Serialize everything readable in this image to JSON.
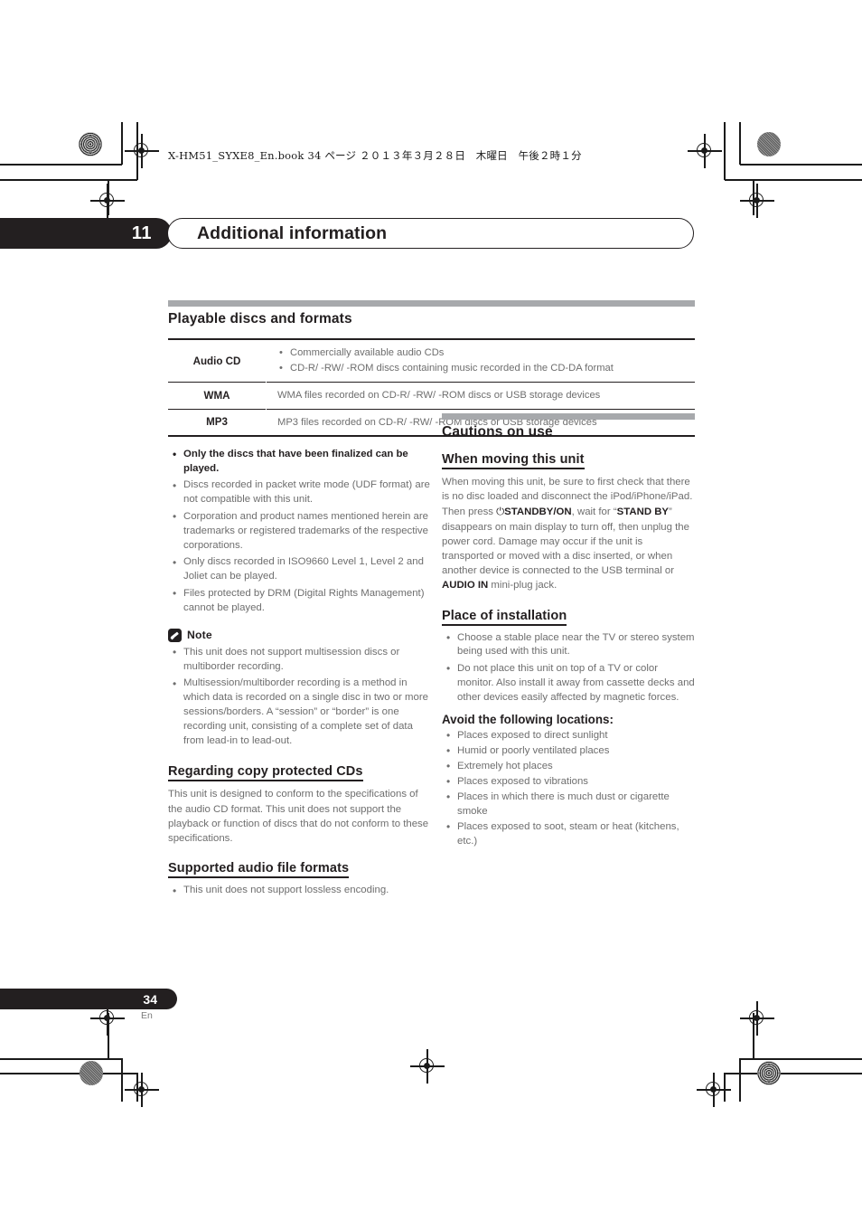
{
  "print_header": {
    "book_line": "X-HM51_SYXE8_En.book  34 ページ  ２０１３年３月２８日　木曜日　午後２時１分"
  },
  "chapter": {
    "number": "11",
    "title": "Additional information"
  },
  "left_column": {
    "section": {
      "title": "Playable discs and formats",
      "table": {
        "rows": [
          {
            "format": "Audio CD",
            "items": [
              "Commercially available audio CDs",
              "CD-R/ -RW/ -ROM discs containing music recorded in the CD-DA format"
            ]
          },
          {
            "format": "WMA",
            "items": [
              "WMA files recorded on CD-R/ -RW/ -ROM discs or USB storage devices"
            ]
          },
          {
            "format": "MP3",
            "items": [
              "MP3 files recorded on CD-R/ -RW/ -ROM discs or USB storage devices"
            ]
          }
        ]
      }
    },
    "notes_list": [
      "Only the discs that have been finalized can be played.",
      "Discs recorded in packet write mode (UDF format) are not compatible with this unit.",
      "Corporation and product names mentioned herein are trademarks or registered trademarks of the respective corporations.",
      "Only discs recorded in ISO9660 Level 1, Level 2 and Joliet can be played.",
      "Files protected by DRM (Digital Rights Management) cannot be played."
    ],
    "note_box": {
      "label": "Note",
      "icon": "pencil-note-icon",
      "items": [
        "This unit does not support multisession discs or multiborder recording.",
        "Multisession/multiborder recording is a method in which data is recorded on a single disc in two or more sessions/borders. A “session” or “border” is one recording unit, consisting of a complete set of data from lead-in to lead-out."
      ]
    },
    "copy_protected": {
      "title": "Regarding copy protected CDs",
      "body": "This unit is designed to conform to the specifications of the audio CD format. This unit does not support the playback or function of discs that do not conform to these specifications."
    },
    "supported_formats": {
      "title": "Supported audio file formats",
      "items": [
        "This unit does not support lossless encoding."
      ]
    }
  },
  "right_column": {
    "section": {
      "title": "Cautions on use"
    },
    "moving": {
      "title": "When moving this unit",
      "body_part_1": "When moving this unit, be sure to first check that there is no disc loaded and disconnect the iPod/iPhone/iPad. Then press ",
      "power_symbol": "⏻",
      "standby_button": "STANDBY/ON",
      "body_part_2": ", wait for “",
      "standby_indicator": "STAND BY",
      "body_part_3": "” disappears on main display to turn off, then unplug the power cord. Damage may occur if the unit is transported or moved with a disc inserted, or when another device is connected to the USB terminal or ",
      "audio_in": "AUDIO IN",
      "body_part_4": " mini-plug jack."
    },
    "installation": {
      "title": "Place of installation",
      "items": [
        "Choose a stable place near the TV or stereo system being used with this unit.",
        "Do not place this unit on top of a TV or color monitor. Also install it away from cassette decks and other devices easily affected by magnetic forces."
      ],
      "avoid_title": "Avoid the following locations:",
      "avoid_items": [
        "Places exposed to direct sunlight",
        "Humid or poorly ventilated places",
        "Extremely hot places",
        "Places exposed to vibrations",
        "Places in which there is much dust or cigarette smoke",
        "Places exposed to soot, steam or heat (kitchens, etc.)"
      ]
    }
  },
  "footer": {
    "page_number": "34",
    "language": "En"
  },
  "colors": {
    "ink": "#231f20",
    "body_gray": "#6e6e6e",
    "rule_gray": "#a7a9ac"
  }
}
